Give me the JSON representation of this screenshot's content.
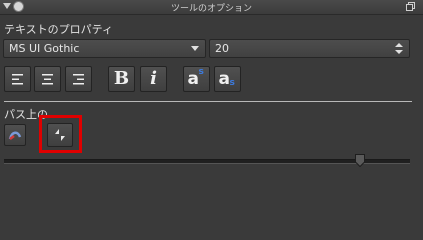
{
  "titlebar": {
    "title": "ツールのオプション"
  },
  "text_properties": {
    "label": "テキストのプロパティ",
    "font_family": "MS UI Gothic",
    "font_size": "20"
  },
  "justify_buttons": [
    {
      "name": "justify-left-button",
      "icon": "align-left-icon"
    },
    {
      "name": "justify-center-button",
      "icon": "align-center-icon"
    },
    {
      "name": "justify-right-button",
      "icon": "align-right-icon"
    }
  ],
  "style_buttons": {
    "bold": "B",
    "italic": "i",
    "superscript": {
      "base": "a",
      "mark": "s"
    },
    "subscript": {
      "base": "a",
      "mark": "s"
    }
  },
  "path_options": {
    "label": "パス上の"
  },
  "colors": {
    "highlight": "#e00000",
    "script_mark": "#3c7be0"
  }
}
